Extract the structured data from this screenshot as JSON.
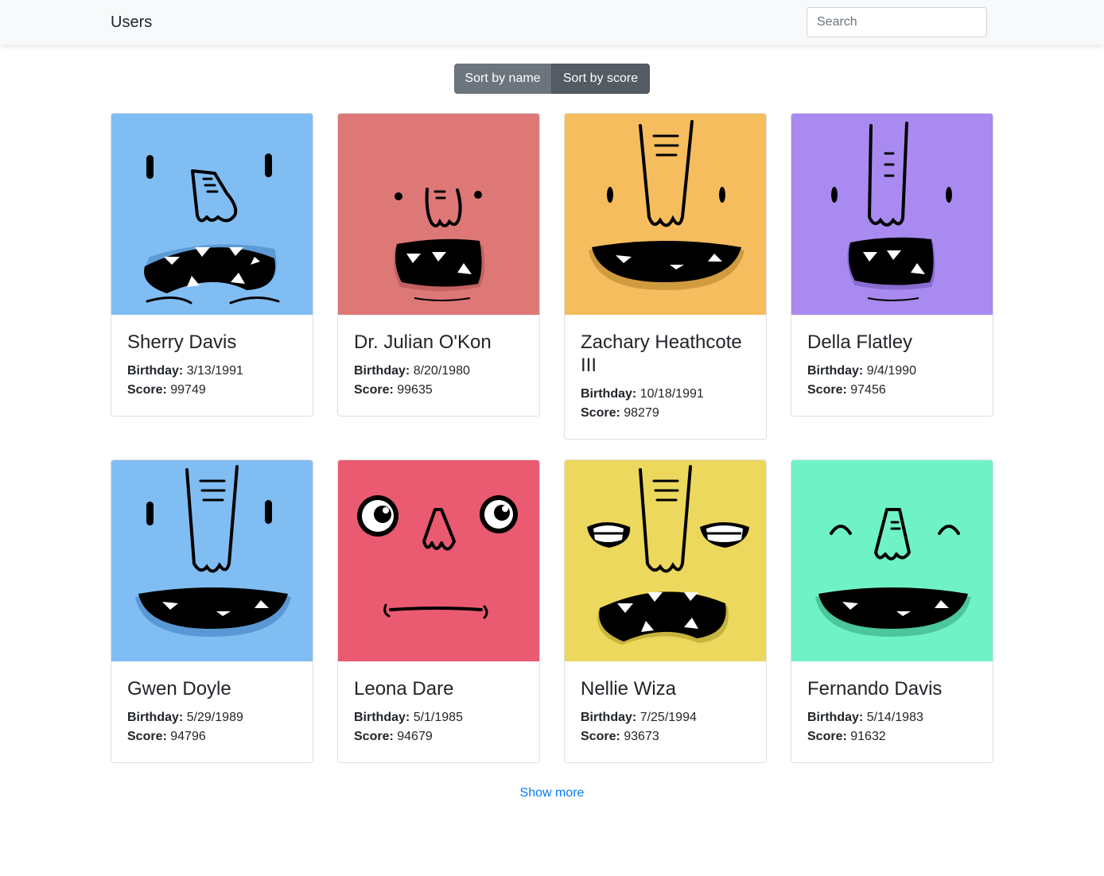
{
  "navbar": {
    "brand": "Users",
    "search_placeholder": "Search"
  },
  "sort": {
    "by_name": "Sort by name",
    "by_score": "Sort by score"
  },
  "labels": {
    "birthday": "Birthday:",
    "score": "Score:"
  },
  "users": [
    {
      "name": "Sherry Davis",
      "birthday": "3/13/1991",
      "score": "99749",
      "avatar_color": "#80bdf2",
      "avatar_icon": "monster-face-icon"
    },
    {
      "name": "Dr. Julian O'Kon",
      "birthday": "8/20/1980",
      "score": "99635",
      "avatar_color": "#de7876",
      "avatar_icon": "monster-face-icon"
    },
    {
      "name": "Zachary Heathcote III",
      "birthday": "10/18/1991",
      "score": "98279",
      "avatar_color": "#f5bd5d",
      "avatar_icon": "monster-face-icon"
    },
    {
      "name": "Della Flatley",
      "birthday": "9/4/1990",
      "score": "97456",
      "avatar_color": "#a88af0",
      "avatar_icon": "monster-face-icon"
    },
    {
      "name": "Gwen Doyle",
      "birthday": "5/29/1989",
      "score": "94796",
      "avatar_color": "#80bdf2",
      "avatar_icon": "monster-face-icon"
    },
    {
      "name": "Leona Dare",
      "birthday": "5/1/1985",
      "score": "94679",
      "avatar_color": "#ea5a70",
      "avatar_icon": "monster-face-icon"
    },
    {
      "name": "Nellie Wiza",
      "birthday": "7/25/1994",
      "score": "93673",
      "avatar_color": "#ecd85c",
      "avatar_icon": "monster-face-icon"
    },
    {
      "name": "Fernando Davis",
      "birthday": "5/14/1983",
      "score": "91632",
      "avatar_color": "#6ff2c6",
      "avatar_icon": "monster-face-icon"
    }
  ],
  "show_more": "Show more",
  "colors": {
    "link": "#007bff",
    "button": "#6c757d",
    "navbar": "#f8f9fa"
  }
}
